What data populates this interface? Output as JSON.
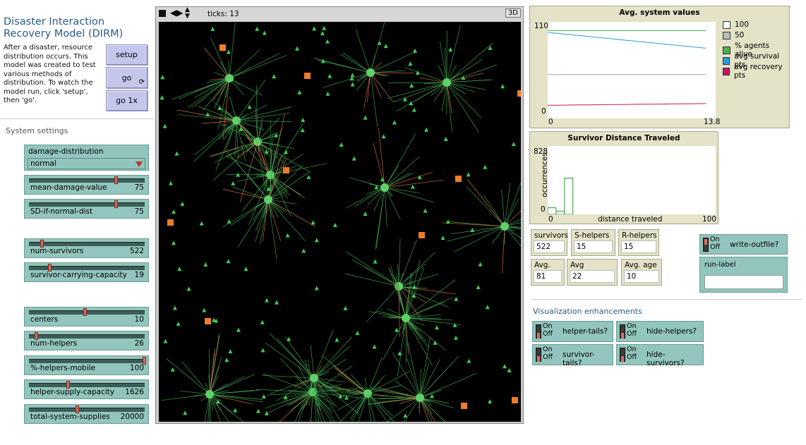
{
  "title": "Disaster Interaction Recovery Model (DIRM)",
  "info": "After a disaster, resource distribution occurs. This model was created to test various methods of distribution. To watch the model run, click 'setup', then 'go'.",
  "buttons": {
    "setup": "setup",
    "go": "go",
    "go_once": "go 1x"
  },
  "system_settings_label": "System settings",
  "chooser": {
    "label": "damage-distribution",
    "value": "normal"
  },
  "sliders": [
    {
      "label": "mean-damage-value",
      "value": "75",
      "fraction": 0.75
    },
    {
      "label": "SD-if-normal-dist",
      "value": "75",
      "fraction": 0.75
    },
    {
      "label": "num-survivors",
      "value": "522",
      "fraction": 0.1
    },
    {
      "label": "survivor-carrying-capacity",
      "value": "19",
      "fraction": 0.17
    },
    {
      "label": "centers",
      "value": "10",
      "fraction": 0.48
    },
    {
      "label": "num-helpers",
      "value": "26",
      "fraction": 0.05
    },
    {
      "label": "%-helpers-mobile",
      "value": "100",
      "fraction": 1.0
    },
    {
      "label": "helper-supply-capacity",
      "value": "1626",
      "fraction": 0.33
    },
    {
      "label": "total-system-supplies",
      "value": "20000",
      "fraction": 0.41
    }
  ],
  "world": {
    "ticks_label": "ticks: 13",
    "three_d": "3D"
  },
  "plot_avg": {
    "title": "Avg. system values",
    "y_max": "110",
    "y_min": "0",
    "x_min": "0",
    "x_max": "13.8",
    "legend": [
      {
        "name": "100",
        "color": "#ffffff"
      },
      {
        "name": "50",
        "color": "#bdbdbd"
      },
      {
        "name": "% agents alive",
        "color": "#4caf50"
      },
      {
        "name": "avg survival pts",
        "color": "#2d9cdb"
      },
      {
        "name": "avg recovery pts",
        "color": "#c2185b"
      }
    ]
  },
  "chart_data": {
    "type": "line",
    "title": "Avg. system values",
    "xlim": [
      0,
      13.8
    ],
    "ylim": [
      0,
      110
    ],
    "x": [
      0,
      13
    ],
    "series": [
      {
        "name": "100",
        "values": [
          100,
          100
        ]
      },
      {
        "name": "50",
        "values": [
          50,
          50
        ]
      },
      {
        "name": "% agents alive",
        "values": [
          100,
          100
        ]
      },
      {
        "name": "avg survival pts",
        "values": [
          98,
          80
        ]
      },
      {
        "name": "avg recovery pts",
        "values": [
          15,
          17
        ]
      }
    ]
  },
  "plot_hist": {
    "title": "Survivor Distance Traveled",
    "y_max": "828",
    "y_min": "0",
    "x_min": "0",
    "x_max": "100",
    "ylabel": "occurrences",
    "xlabel": "distance traveled",
    "bars": [
      {
        "x0": 0,
        "x1": 5,
        "value": 80
      },
      {
        "x0": 5,
        "x1": 10,
        "value": 40
      },
      {
        "x0": 10,
        "x1": 15,
        "value": 440
      }
    ]
  },
  "monitors": [
    {
      "label": "survivors",
      "value": "522"
    },
    {
      "label": "S-helpers",
      "value": "15"
    },
    {
      "label": "R-helpers",
      "value": "15"
    },
    {
      "label": "Avg. life",
      "value": "81"
    },
    {
      "label": "Avg recovery",
      "value": "22"
    },
    {
      "label": "Avg. age",
      "value": "10"
    }
  ],
  "switches": {
    "write_outfile": {
      "on": "On",
      "off": "Off",
      "label": "write-outfile?"
    },
    "helper_tails": {
      "on": "On",
      "off": "Off",
      "label": "helper-tails?"
    },
    "hide_helpers": {
      "on": "On",
      "off": "Off",
      "label": "hide-helpers?"
    },
    "survivor_tails": {
      "on": "On",
      "off": "Off",
      "label": "survivor-tails?"
    },
    "hide_survivors": {
      "on": "On",
      "off": "Off",
      "label": "hide-survivors?"
    }
  },
  "run_label": {
    "label": "run-label",
    "value": ""
  },
  "viz_label": "Visualization enhancements"
}
